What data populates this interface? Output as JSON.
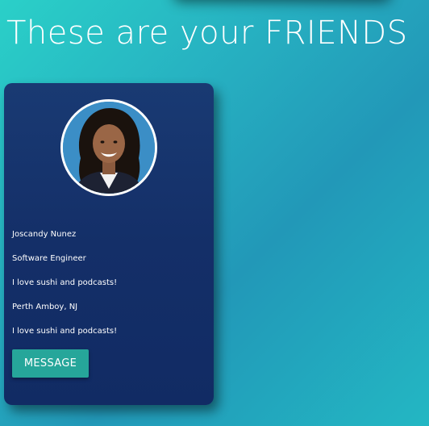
{
  "page": {
    "title": "These are your FRIENDS"
  },
  "friend_card": {
    "name": "Joscandy Nunez",
    "occupation": "Software Engineer",
    "bio": "I love sushi and podcasts!",
    "location": "Perth Amboy, NJ",
    "bio_repeat": "I love sushi and podcasts!",
    "message_label": "MESSAGE",
    "avatar_icon": "profile-photo"
  },
  "colors": {
    "background": "#27b3c2",
    "card": "#142f68",
    "button": "#26a69a",
    "text": "#ffffff"
  }
}
